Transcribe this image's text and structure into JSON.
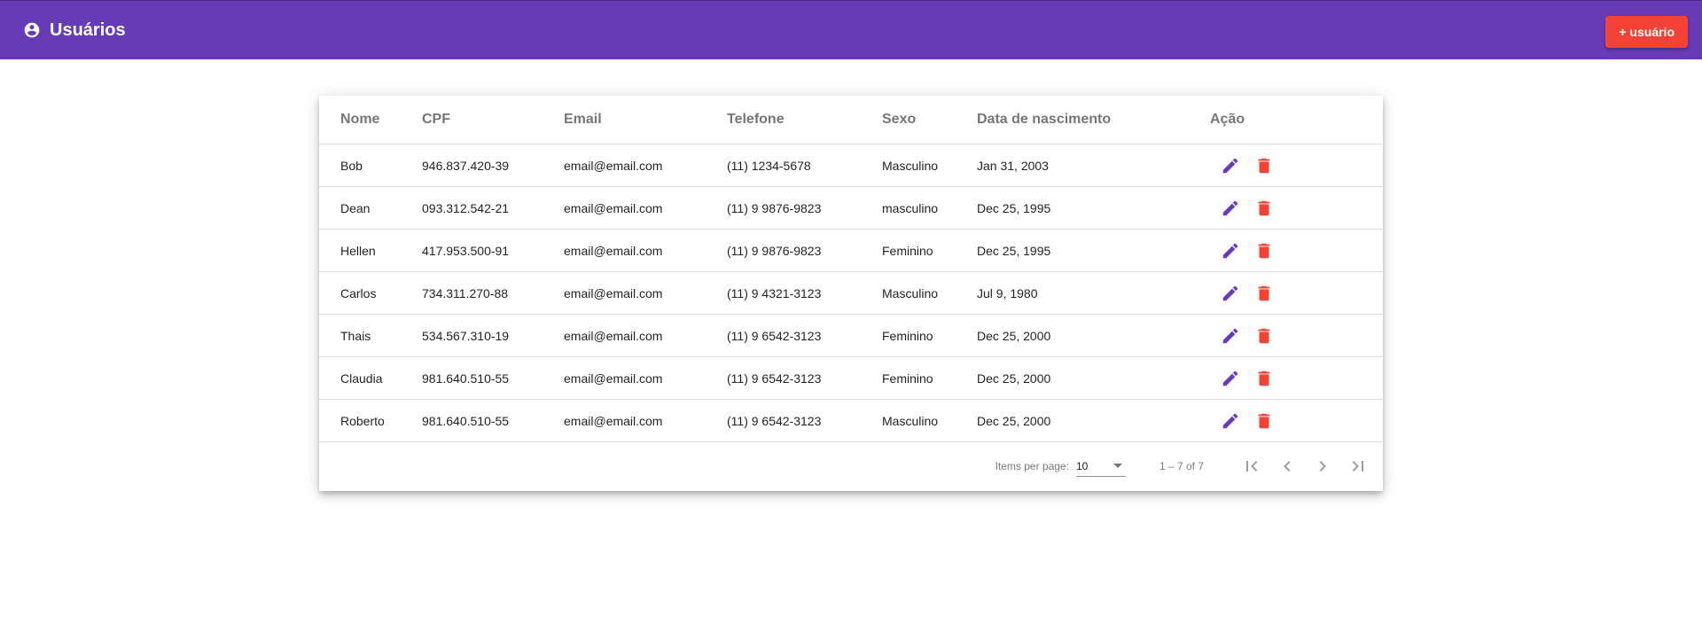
{
  "app": {
    "title": "Usuários",
    "add_button_label": "+ usuário"
  },
  "colors": {
    "primary": "#673ab7",
    "accent": "#f44336"
  },
  "table": {
    "headers": {
      "nome": "Nome",
      "cpf": "CPF",
      "email": "Email",
      "telefone": "Telefone",
      "sexo": "Sexo",
      "data": "Data de nascimento",
      "acao": "Ação"
    },
    "rows": [
      {
        "nome": "Bob",
        "cpf": "946.837.420-39",
        "email": "email@email.com",
        "telefone": "(11) 1234-5678",
        "sexo": "Masculino",
        "data": "Jan 31, 2003"
      },
      {
        "nome": "Dean",
        "cpf": "093.312.542-21",
        "email": "email@email.com",
        "telefone": "(11) 9 9876-9823",
        "sexo": "masculino",
        "data": "Dec 25, 1995"
      },
      {
        "nome": "Hellen",
        "cpf": "417.953.500-91",
        "email": "email@email.com",
        "telefone": "(11) 9 9876-9823",
        "sexo": "Feminino",
        "data": "Dec 25, 1995"
      },
      {
        "nome": "Carlos",
        "cpf": "734.311.270-88",
        "email": "email@email.com",
        "telefone": "(11) 9 4321-3123",
        "sexo": "Masculino",
        "data": "Jul 9, 1980"
      },
      {
        "nome": "Thais",
        "cpf": "534.567.310-19",
        "email": "email@email.com",
        "telefone": "(11) 9 6542-3123",
        "sexo": "Feminino",
        "data": "Dec 25, 2000"
      },
      {
        "nome": "Claudia",
        "cpf": "981.640.510-55",
        "email": "email@email.com",
        "telefone": "(11) 9 6542-3123",
        "sexo": "Feminino",
        "data": "Dec 25, 2000"
      },
      {
        "nome": "Roberto",
        "cpf": "981.640.510-55",
        "email": "email@email.com",
        "telefone": "(11) 9 6542-3123",
        "sexo": "Masculino",
        "data": "Dec 25, 2000"
      }
    ],
    "action_icons": [
      "edit-icon",
      "delete-icon"
    ]
  },
  "paginator": {
    "items_per_page_label": "Items per page:",
    "items_per_page_value": "10",
    "range_label": "1 – 7 of 7"
  }
}
